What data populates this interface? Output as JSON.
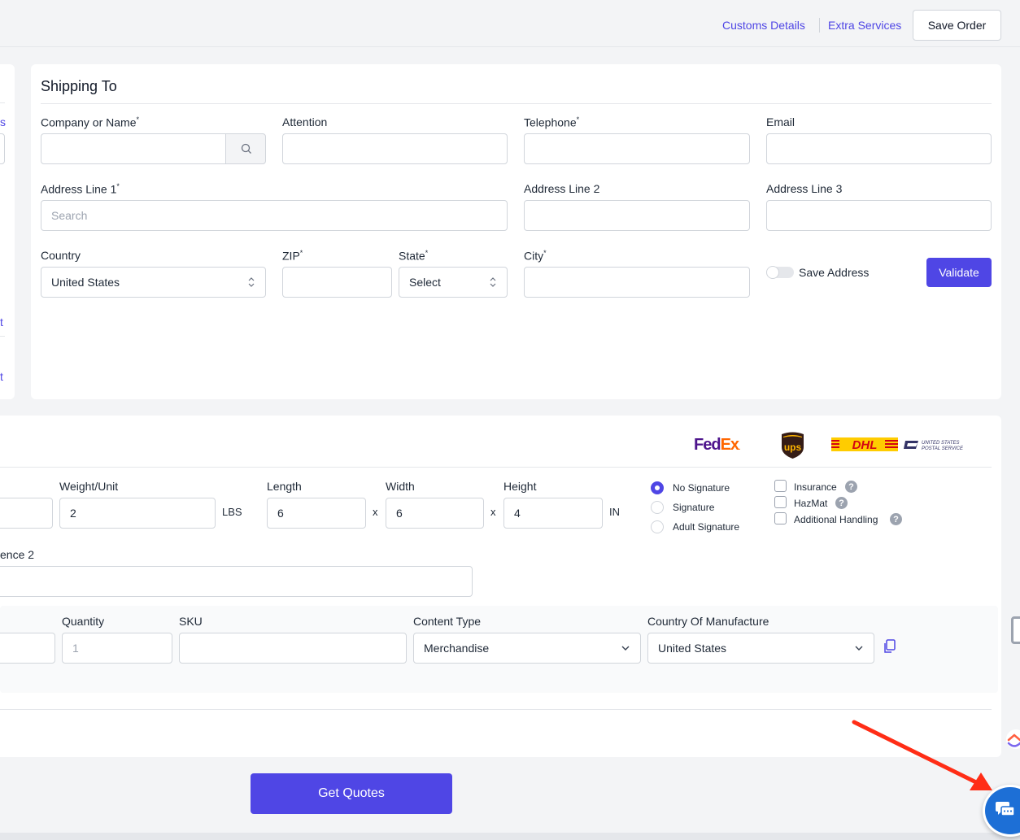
{
  "header": {
    "customs_details": "Customs Details",
    "extra_services": "Extra Services",
    "save_order": "Save Order"
  },
  "left_panel": {
    "fragment_1": "s",
    "fragment_2": "t",
    "fragment_3": "t"
  },
  "shipping_to": {
    "title": "Shipping To",
    "company_label": "Company or Name",
    "attention_label": "Attention",
    "telephone_label": "Telephone",
    "email_label": "Email",
    "address1_label": "Address Line 1",
    "address1_placeholder": "Search",
    "address2_label": "Address Line 2",
    "address3_label": "Address Line 3",
    "country_label": "Country",
    "country_value": "United States",
    "zip_label": "ZIP",
    "state_label": "State",
    "state_value": "Select",
    "city_label": "City",
    "save_address_label": "Save Address",
    "save_address_on": false,
    "validate_button": "Validate",
    "required_mark": "*"
  },
  "package": {
    "carriers": [
      "FedEx",
      "ups",
      "DHL",
      "UNITED STATES POSTAL SERVICE"
    ],
    "weight_label": "Weight/Unit",
    "weight_value": "2",
    "weight_unit": "LBS",
    "length_label": "Length",
    "length_value": "6",
    "width_label": "Width",
    "width_value": "6",
    "height_label": "Height",
    "height_value": "4",
    "times": "x",
    "dim_unit": "IN",
    "signature_options": [
      "No Signature",
      "Signature",
      "Adult Signature"
    ],
    "signature_selected": "No Signature",
    "extras": [
      "Insurance",
      "HazMat",
      "Additional Handling"
    ],
    "help_glyph": "?",
    "reference2_label": "ence 2"
  },
  "item": {
    "quantity_label": "Quantity",
    "quantity_placeholder": "1",
    "sku_label": "SKU",
    "content_type_label": "Content Type",
    "content_type_value": "Merchandise",
    "country_manufacture_label": "Country Of Manufacture",
    "country_manufacture_value": "United States"
  },
  "actions": {
    "get_quotes": "Get Quotes"
  },
  "colors": {
    "accent": "#4f46e5",
    "fedex_purple": "#4d148c",
    "fedex_orange": "#ff6600",
    "ups_brown": "#351c15",
    "ups_gold": "#ffb500",
    "dhl_yellow": "#ffcc00",
    "dhl_red": "#d40511",
    "chat_blue": "#1d6fd6",
    "annotation_red": "#ff2d16"
  }
}
